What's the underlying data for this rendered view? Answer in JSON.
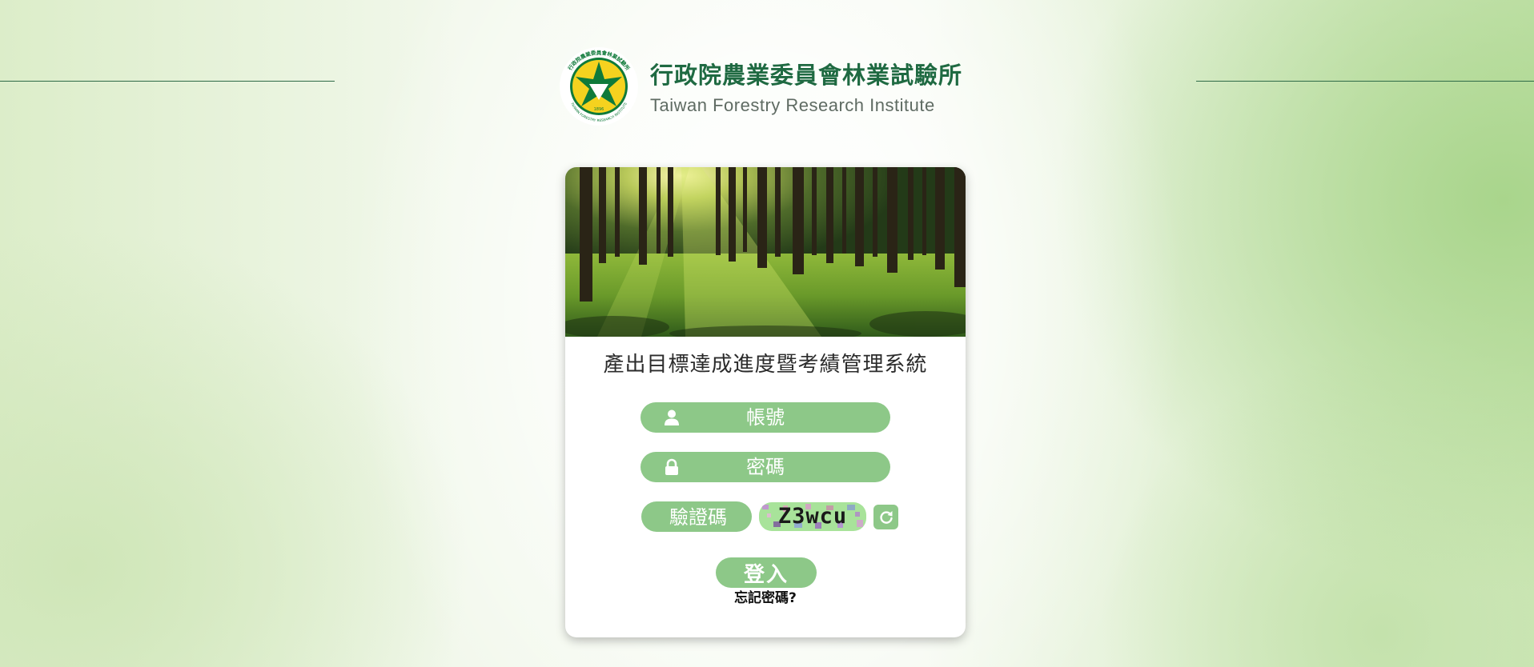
{
  "header": {
    "title_zh": "行政院農業委員會林業試驗所",
    "title_en": "Taiwan Forestry Research Institute",
    "logo_ring_top": "行政院農業委員會林業試驗所",
    "logo_ring_bottom": "TAIWAN FORESTRY RESEARCH INSTITUTE",
    "logo_year": "1896"
  },
  "login": {
    "system_title": "產出目標達成進度暨考績管理系統",
    "account_placeholder": "帳號",
    "password_placeholder": "密碼",
    "captcha_placeholder": "驗證碼",
    "captcha_text": "Z3wcu",
    "login_label": "登入",
    "forgot_label": "忘記密碼?"
  },
  "icons": {
    "user": "user-icon",
    "lock": "lock-icon",
    "refresh": "refresh-icon"
  },
  "colors": {
    "accent_green": "#8dc888",
    "brand_dark_green": "#1f6a42",
    "logo_yellow": "#f5d21f"
  }
}
